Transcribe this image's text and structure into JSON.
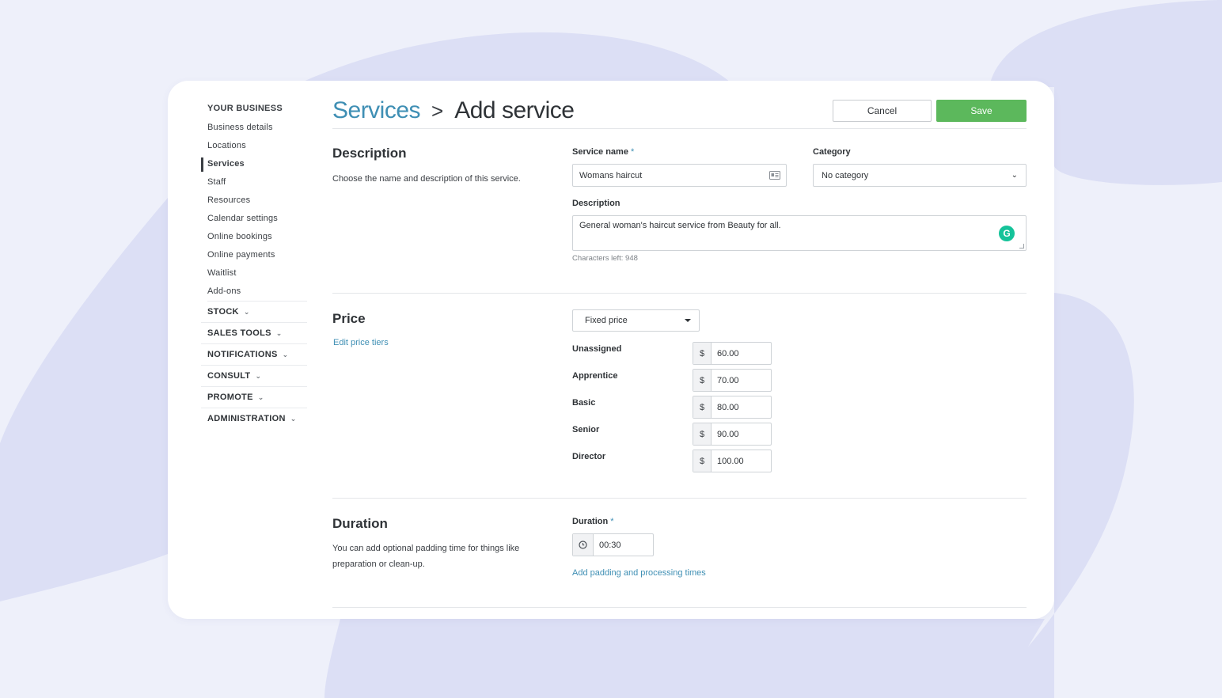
{
  "sidebar": {
    "section_title": "YOUR BUSINESS",
    "items": [
      {
        "label": "Business details"
      },
      {
        "label": "Locations"
      },
      {
        "label": "Services"
      },
      {
        "label": "Staff"
      },
      {
        "label": "Resources"
      },
      {
        "label": "Calendar settings"
      },
      {
        "label": "Online bookings"
      },
      {
        "label": "Online payments"
      },
      {
        "label": "Waitlist"
      },
      {
        "label": "Add-ons"
      }
    ],
    "active_item": "Services",
    "groups": [
      {
        "label": "STOCK"
      },
      {
        "label": "SALES TOOLS"
      },
      {
        "label": "NOTIFICATIONS"
      },
      {
        "label": "CONSULT"
      },
      {
        "label": "PROMOTE"
      },
      {
        "label": "ADMINISTRATION"
      }
    ]
  },
  "header": {
    "breadcrumb_parent": "Services",
    "breadcrumb_separator": ">",
    "title": "Add service",
    "cancel_label": "Cancel",
    "save_label": "Save"
  },
  "description_section": {
    "title": "Description",
    "help": "Choose the name and description of this service.",
    "service_name_label": "Service name",
    "required_mark": "*",
    "service_name_value": "Womans haircut",
    "category_label": "Category",
    "category_value": "No category",
    "description_label": "Description",
    "description_value": "General woman's haircut service from Beauty for all.",
    "characters_left": "Characters left: 948"
  },
  "price_section": {
    "title": "Price",
    "edit_tiers_link": "Edit price tiers",
    "price_type": "Fixed price",
    "currency_symbol": "$",
    "tiers": [
      {
        "label": "Unassigned",
        "value": "60.00"
      },
      {
        "label": "Apprentice",
        "value": "70.00"
      },
      {
        "label": "Basic",
        "value": "80.00"
      },
      {
        "label": "Senior",
        "value": "90.00"
      },
      {
        "label": "Director",
        "value": "100.00"
      }
    ]
  },
  "duration_section": {
    "title": "Duration",
    "help": "You can add optional padding time for things like preparation or clean-up.",
    "duration_label": "Duration",
    "required_mark": "*",
    "duration_value": "00:30",
    "padding_link": "Add padding and processing times"
  },
  "colors": {
    "accent": "#3f8fb4",
    "save_green": "#5cb85c",
    "background": "#eef0fa",
    "blob": "#dcdff5"
  }
}
